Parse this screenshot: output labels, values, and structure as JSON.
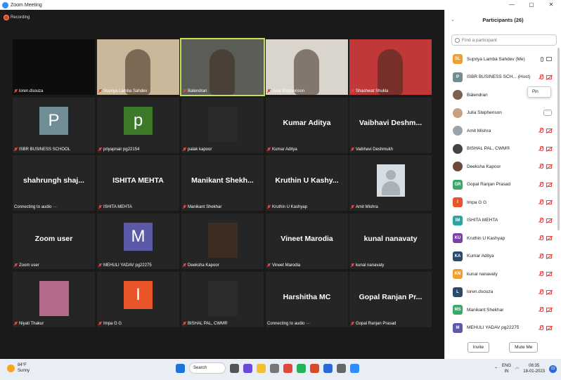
{
  "window": {
    "title": "Zoom Meeting",
    "controls": [
      "—",
      "▢",
      "✕"
    ]
  },
  "recording": {
    "label": "Recording"
  },
  "tiles": [
    {
      "name": "loren.dsouza",
      "kind": "video",
      "bg": "#0d0d0d"
    },
    {
      "name": "Supriya Lamba Sahdev",
      "kind": "video",
      "bg": "#c9b89a"
    },
    {
      "name": "Balendran",
      "kind": "video",
      "bg": "#5b5d57",
      "active": true
    },
    {
      "name": "Julia Stephenson",
      "kind": "video",
      "bg": "#d9d4cc"
    },
    {
      "name": "Shashwat Shukla",
      "kind": "video",
      "bg": "#c03838"
    },
    {
      "name": "ISBR BUSINESS SCHOOL",
      "kind": "letter",
      "letter": "P",
      "color": "#708c94"
    },
    {
      "name": "priyapnair pg22154",
      "kind": "letter",
      "letter": "p",
      "color": "#3c7a2a"
    },
    {
      "name": "palak kapoor",
      "kind": "photo",
      "bg": "#2a2a2a"
    },
    {
      "name": "Kumar Aditya",
      "kind": "text",
      "display": "Kumar Aditya"
    },
    {
      "name": "Vaibhavi Deshmukh",
      "kind": "text",
      "display": "Vaibhavi  Deshm..."
    },
    {
      "name": "Connecting to audio ···",
      "kind": "text",
      "display": "shahrungh  shaj..."
    },
    {
      "name": "ISHITA MEHTA",
      "kind": "text",
      "display": "ISHITA MEHTA"
    },
    {
      "name": "Manikant Shekhar",
      "kind": "text",
      "display": "Manikant  Shekh..."
    },
    {
      "name": "Kruthin U Kashyap",
      "kind": "text",
      "display": "Kruthin  U  Kashy..."
    },
    {
      "name": "Amit Mishra",
      "kind": "avatar",
      "bg": "#3a3a3a"
    },
    {
      "name": "Zoom user",
      "kind": "text",
      "display": "Zoom user"
    },
    {
      "name": "MEHULI YADAV pg22275",
      "kind": "letter",
      "letter": "M",
      "color": "#5b5aa8"
    },
    {
      "name": "Deeksha Kapoor",
      "kind": "photo",
      "bg": "#3b2d22"
    },
    {
      "name": "Vineet Marodia",
      "kind": "text",
      "display": "Vineet Marodia"
    },
    {
      "name": "kunal nanavaty",
      "kind": "text",
      "display": "kunal nanavaty"
    },
    {
      "name": "Niyati Thakur",
      "kind": "photo",
      "bg": "#b56a8c"
    },
    {
      "name": "Impa G G",
      "kind": "letter",
      "letter": "I",
      "color": "#e8552a"
    },
    {
      "name": "BISHAL PAL, CWM®",
      "kind": "photo",
      "bg": "#2c2c2c"
    },
    {
      "name": "Connecting to audio ···",
      "kind": "text",
      "display": "Harshitha MC"
    },
    {
      "name": "Gopal Ranjan Prasad",
      "kind": "text",
      "display": "Gopal  Ranjan  Pr..."
    }
  ],
  "participants": {
    "title": "Participants (26)",
    "search_placeholder": "Find a participant",
    "pin_label": "Pin",
    "invite_label": "Invite",
    "mute_me_label": "Mute Me",
    "list": [
      {
        "initials": "SL",
        "name": "Supriya Lamba Sahdev (Me)",
        "color": "#f0a030",
        "state": "on"
      },
      {
        "initials": "P",
        "name": "ISBR BUSINESS SCH...   (Host)",
        "color": "#708c94",
        "state": "muted"
      },
      {
        "initials": "",
        "name": "Balendran",
        "color": "#7a6050",
        "state": "pin",
        "img": true
      },
      {
        "initials": "",
        "name": "Julia Stephenson",
        "color": "#c8a080",
        "state": "more",
        "img": true
      },
      {
        "initials": "",
        "name": "Amit Mishra",
        "color": "#9aa4ad",
        "state": "muted",
        "img": true
      },
      {
        "initials": "",
        "name": "BISHAL PAL, CWM®",
        "color": "#444",
        "state": "muted",
        "img": true
      },
      {
        "initials": "",
        "name": "Deeksha Kapoor",
        "color": "#6b4a38",
        "state": "muted",
        "img": true
      },
      {
        "initials": "GR",
        "name": "Gopal Ranjan Prasad",
        "color": "#3aa86a",
        "state": "muted"
      },
      {
        "initials": "I",
        "name": "Impa G G",
        "color": "#e8552a",
        "state": "muted"
      },
      {
        "initials": "IM",
        "name": "ISHITA MEHTA",
        "color": "#2aa5a0",
        "state": "muted"
      },
      {
        "initials": "KU",
        "name": "Kruthin U Kashyap",
        "color": "#7b3fa8",
        "state": "muted"
      },
      {
        "initials": "KA",
        "name": "Kumar Aditya",
        "color": "#2a4a6a",
        "state": "muted"
      },
      {
        "initials": "KN",
        "name": "kunal nanavaty",
        "color": "#f0a030",
        "state": "muted"
      },
      {
        "initials": "L",
        "name": "loren.dsouza",
        "color": "#2a4a6a",
        "state": "muted"
      },
      {
        "initials": "MS",
        "name": "Manikant Shekhar",
        "color": "#3aa86a",
        "state": "muted"
      },
      {
        "initials": "M",
        "name": "MEHULI YADAV pg22275",
        "color": "#5b5aa8",
        "state": "muted"
      }
    ]
  },
  "taskbar": {
    "weather_temp": "84°F",
    "weather_desc": "Sunny",
    "search_label": "Search",
    "lang_top": "ENG",
    "lang_bottom": "IN",
    "time": "08:35",
    "date": "18-01-2023",
    "notification_count": "23",
    "chat_badge": "1"
  }
}
